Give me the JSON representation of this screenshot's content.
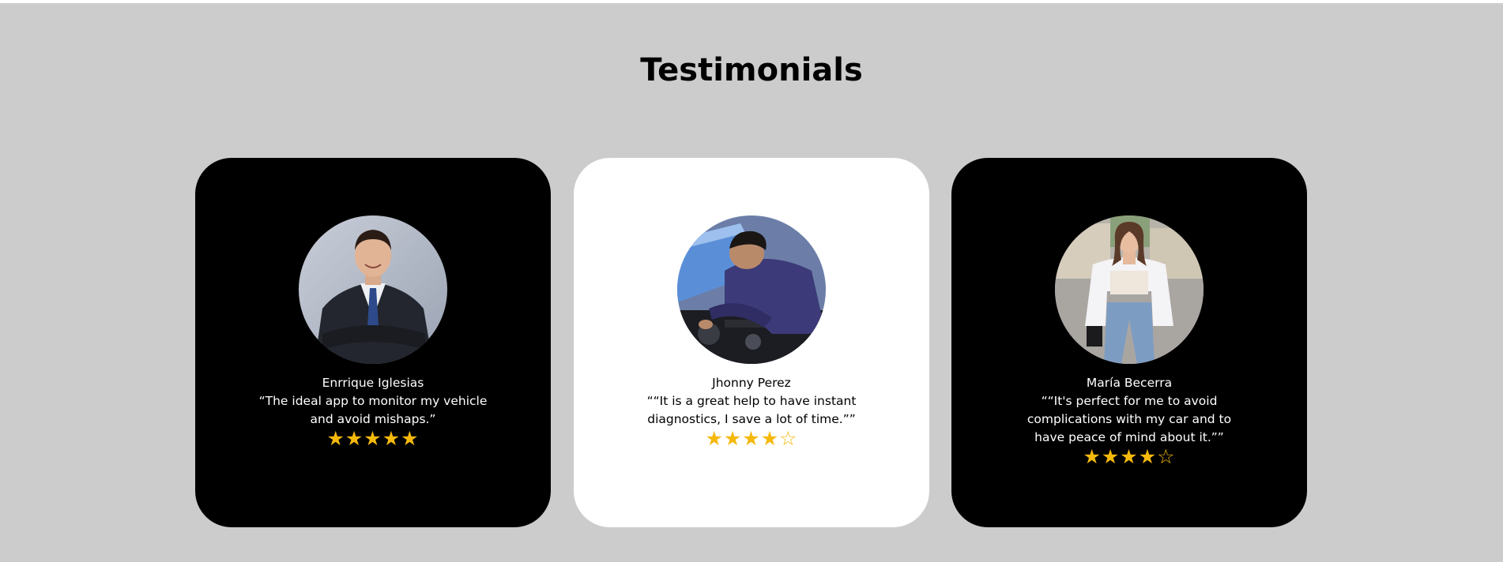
{
  "section": {
    "title": "Testimonials"
  },
  "testimonials": [
    {
      "theme": "dark",
      "name": "Enrrique Iglesias",
      "quote": "“The ideal app to monitor my vehicle and avoid mishaps.”",
      "rating": 5,
      "max_rating": 5,
      "stars": "★★★★★",
      "photo": "businessman-portrait"
    },
    {
      "theme": "light",
      "name": "Jhonny Perez",
      "quote": "““It is a great help to have instant diagnostics, I save a lot of time.””",
      "rating": 4,
      "max_rating": 5,
      "stars": "★★★★☆",
      "photo": "mechanic-at-engine"
    },
    {
      "theme": "dark",
      "name": "María Becerra",
      "quote": "““It's perfect for me to avoid complications with my car and to have peace of mind about it.””",
      "rating": 4,
      "max_rating": 5,
      "stars": "★★★★☆",
      "photo": "woman-walking-street"
    }
  ],
  "colors": {
    "background": "#cccccc",
    "dark_card": "#000000",
    "light_card": "#ffffff",
    "star": "#f5b90c"
  }
}
